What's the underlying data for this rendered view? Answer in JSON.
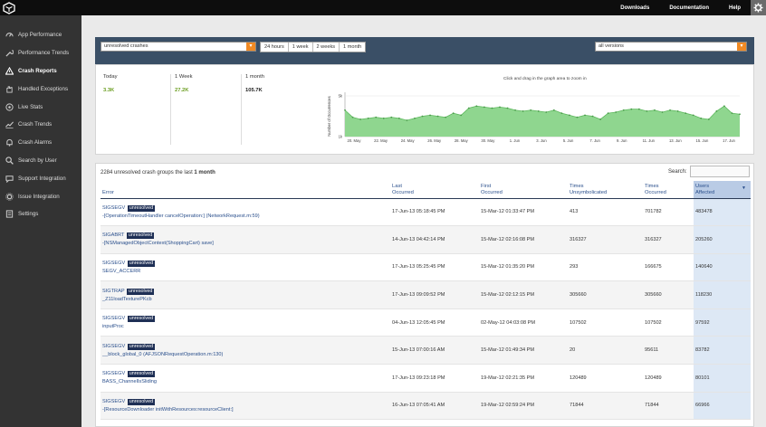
{
  "topbar": {
    "links": [
      "Downloads",
      "Documentation",
      "Help"
    ]
  },
  "sidebar": {
    "items": [
      {
        "label": "App Performance",
        "icon": "gauge-icon"
      },
      {
        "label": "Performance Trends",
        "icon": "wrench-icon"
      },
      {
        "label": "Crash Reports",
        "icon": "warning-icon",
        "active": true
      },
      {
        "label": "Handled Exceptions",
        "icon": "hand-icon"
      },
      {
        "label": "Live Stats",
        "icon": "pulse-icon"
      },
      {
        "label": "Crash Trends",
        "icon": "trend-icon"
      },
      {
        "label": "Crash Alarms",
        "icon": "bell-icon"
      },
      {
        "label": "Search by User",
        "icon": "search-icon"
      },
      {
        "label": "Support Integration",
        "icon": "chat-icon"
      },
      {
        "label": "Issue Integration",
        "icon": "gear-icon"
      },
      {
        "label": "Settings",
        "icon": "settings-icon"
      }
    ]
  },
  "filters": {
    "crash_type": "unresolved crashes",
    "ranges": [
      "24 hours",
      "1 week",
      "2 weeks",
      "1 month"
    ],
    "version": "all versions"
  },
  "stats": {
    "today_label": "Today",
    "today_value": "3.3K",
    "week_label": "1 Week",
    "week_value": "27.2K",
    "month_label": "1 month",
    "month_value": "105.7K",
    "hint": "Click and drag in the graph area to zoom in"
  },
  "colors": {
    "today": "#6a9d1f",
    "week": "#6a9d1f",
    "month": "#222222",
    "chart_fill": "#8fd68f",
    "chart_line": "#5cb85c",
    "accent": "#f08a24"
  },
  "chart_data": {
    "type": "area",
    "ylabel": "Number of Occurrences",
    "y_ticks": [
      "5k",
      "1k"
    ],
    "x_ticks": [
      "20. May",
      "22. May",
      "24. May",
      "26. May",
      "28. May",
      "30. May",
      "1. Jun",
      "3. Jun",
      "5. Jun",
      "7. Jun",
      "9. Jun",
      "11. Jun",
      "13. Jun",
      "15. Jun",
      "17. Jun"
    ],
    "values": [
      3.6,
      2.9,
      2.7,
      2.8,
      2.9,
      2.8,
      2.9,
      2.8,
      2.6,
      2.8,
      3.0,
      3.1,
      3.0,
      2.9,
      3.3,
      3.1,
      3.8,
      4.0,
      3.9,
      3.8,
      3.9,
      3.8,
      3.6,
      3.5,
      3.6,
      3.5,
      3.4,
      3.6,
      3.3,
      3.1,
      2.9,
      3.1,
      3.0,
      2.7,
      3.3,
      3.4,
      3.6,
      3.7,
      3.7,
      3.5,
      3.6,
      3.4,
      3.6,
      3.5,
      3.3,
      3.1,
      2.8,
      2.7,
      3.5,
      4.0,
      3.3,
      3.2
    ],
    "ylim": [
      1,
      5
    ]
  },
  "table": {
    "count": "2284",
    "caption_mid": "unresolved crash groups the last",
    "caption_bold": "1 month",
    "search_label": "Search:",
    "columns": [
      "Error",
      "Last Occurred",
      "First Occurred",
      "Times Unsymbolicated",
      "Times Occurred",
      "Users Affected"
    ],
    "rows": [
      {
        "sig": "SIGSEGV",
        "status": "unresolved",
        "detail": "-[OperationTimeoutHandler cancelOperation:] (NetworkRequest.m:59)",
        "last": "17-Jun-13 05:18:45 PM",
        "first": "15-Mar-12 01:33:47 PM",
        "unsym": "413",
        "times": "701782",
        "users": "483478"
      },
      {
        "sig": "SIGABRT",
        "status": "unresolved",
        "detail": "-[NSManagedObjectContext(ShoppingCart) save]",
        "last": "14-Jun-13 04:42:14 PM",
        "first": "15-Mar-12 02:16:08 PM",
        "unsym": "316327",
        "times": "316327",
        "users": "205260"
      },
      {
        "sig": "SIGSEGV",
        "status": "unresolved",
        "detail": "SEGV_ACCERR",
        "last": "17-Jun-13 05:25:45 PM",
        "first": "15-Mar-12 01:35:20 PM",
        "unsym": "293",
        "times": "166675",
        "users": "140640"
      },
      {
        "sig": "SIGTRAP",
        "status": "unresolved",
        "detail": "_Z11loadTexturePKcb",
        "last": "17-Jun-13 09:09:52 PM",
        "first": "15-Mar-12 02:12:15 PM",
        "unsym": "305660",
        "times": "305660",
        "users": "118230"
      },
      {
        "sig": "SIGSEGV",
        "status": "unresolved",
        "detail": "inputProc",
        "last": "04-Jun-13 12:05:45 PM",
        "first": "02-May-12 04:03:08 PM",
        "unsym": "107502",
        "times": "107502",
        "users": "97592"
      },
      {
        "sig": "SIGSEGV",
        "status": "unresolved",
        "detail": "__block_global_0 (AFJSONRequestOperation.m:130)",
        "last": "15-Jun-13 07:00:16 AM",
        "first": "15-Mar-12 01:49:34 PM",
        "unsym": "20",
        "times": "95611",
        "users": "83782"
      },
      {
        "sig": "SIGSEGV",
        "status": "unresolved",
        "detail": "BASS_ChannelIsSliding",
        "last": "17-Jun-13 09:23:18 PM",
        "first": "19-Mar-12 02:21:35 PM",
        "unsym": "120489",
        "times": "120489",
        "users": "80101"
      },
      {
        "sig": "SIGSEGV",
        "status": "unresolved",
        "detail": "-[ResourceDownloader initWithResources:resourceClient:]",
        "last": "16-Jun-13 07:05:41 AM",
        "first": "19-Mar-12 02:59:24 PM",
        "unsym": "71844",
        "times": "71844",
        "users": "66966"
      }
    ]
  }
}
